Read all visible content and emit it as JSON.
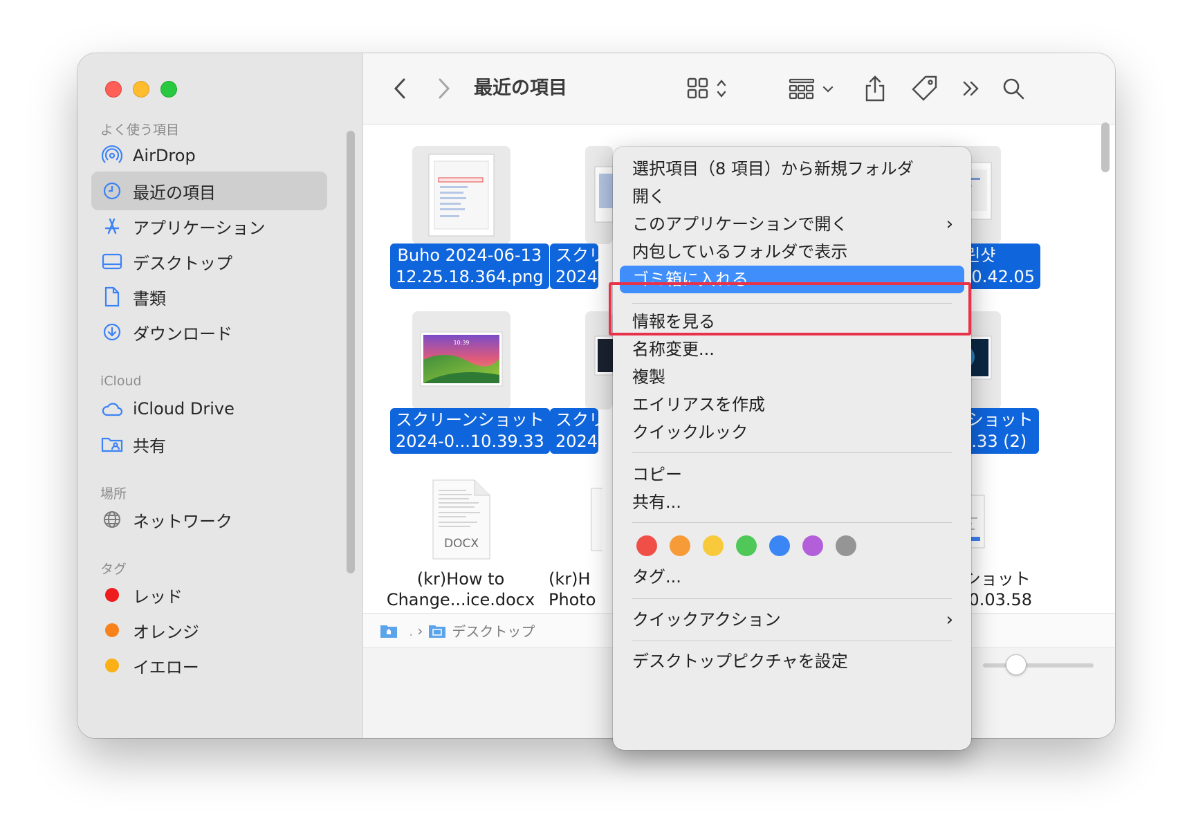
{
  "sidebar": {
    "favorites_header": "よく使う項目",
    "favorites": [
      {
        "label": "AirDrop",
        "icon": "airdrop-icon"
      },
      {
        "label": "最近の項目",
        "icon": "clock-icon"
      },
      {
        "label": "アプリケーション",
        "icon": "applications-icon"
      },
      {
        "label": "デスクトップ",
        "icon": "desktop-icon"
      },
      {
        "label": "書類",
        "icon": "document-icon"
      },
      {
        "label": "ダウンロード",
        "icon": "download-icon"
      }
    ],
    "icloud_header": "iCloud",
    "icloud": [
      {
        "label": "iCloud Drive",
        "icon": "cloud-icon"
      },
      {
        "label": "共有",
        "icon": "shared-folder-icon"
      }
    ],
    "locations_header": "場所",
    "locations": [
      {
        "label": "ネットワーク",
        "icon": "network-icon"
      }
    ],
    "tags_header": "タグ",
    "tags": [
      {
        "label": "レッド",
        "color": "#ee1c1c"
      },
      {
        "label": "オレンジ",
        "color": "#f7821b"
      },
      {
        "label": "イエロー",
        "color": "#fbb018"
      }
    ]
  },
  "toolbar": {
    "title": "最近の項目"
  },
  "files": [
    {
      "line1": "Buho 2024-06-13",
      "line2": "12.25.18.364.png",
      "selected": true
    },
    {
      "line1": "スクリ",
      "line2": "2024",
      "selected": true
    },
    {
      "line1": "스크린샷",
      "line2": "0...10.42.05",
      "selected": true
    },
    {
      "line1": "スクリーンショット",
      "line2": "2024-0...10.39.33",
      "selected": true
    },
    {
      "line1": "スクリ",
      "line2": "2024",
      "selected": true
    },
    {
      "line1": "ーンショット",
      "line2": "0...9.33 (2)",
      "selected": true
    },
    {
      "line1": "(kr)How to",
      "line2": "Change...ice.docx",
      "selected": false,
      "doc_label": "DOCX"
    },
    {
      "line1": "(kr)H",
      "line2": "Photo",
      "selected": false
    },
    {
      "line1": "ーンショット",
      "line2": "0...20.03.58",
      "selected": false
    }
  ],
  "pathbar": {
    "separator": "›",
    "folder": "デスクトップ"
  },
  "context_menu": {
    "items": [
      {
        "label": "選択項目（8 項目）から新規フォルダ"
      },
      {
        "label": "開く"
      },
      {
        "label": "このアプリケーションで開く",
        "submenu": true
      },
      {
        "label": "内包しているフォルダで表示"
      },
      {
        "label": "ゴミ箱に入れる",
        "highlighted": true
      },
      {
        "label": "情報を見る"
      },
      {
        "label": "名称変更..."
      },
      {
        "label": "複製"
      },
      {
        "label": "エイリアスを作成"
      },
      {
        "label": "クイックルック"
      },
      {
        "label": "コピー"
      },
      {
        "label": "共有..."
      },
      {
        "label": "タグ..."
      },
      {
        "label": "クイックアクション",
        "submenu": true
      },
      {
        "label": "デスクトップピクチャを設定"
      }
    ],
    "submenu_chevron": "›",
    "tag_colors": [
      "#f04f47",
      "#f79b38",
      "#f9c93c",
      "#4fc857",
      "#3a86f5",
      "#b35fd9",
      "#959595"
    ]
  }
}
